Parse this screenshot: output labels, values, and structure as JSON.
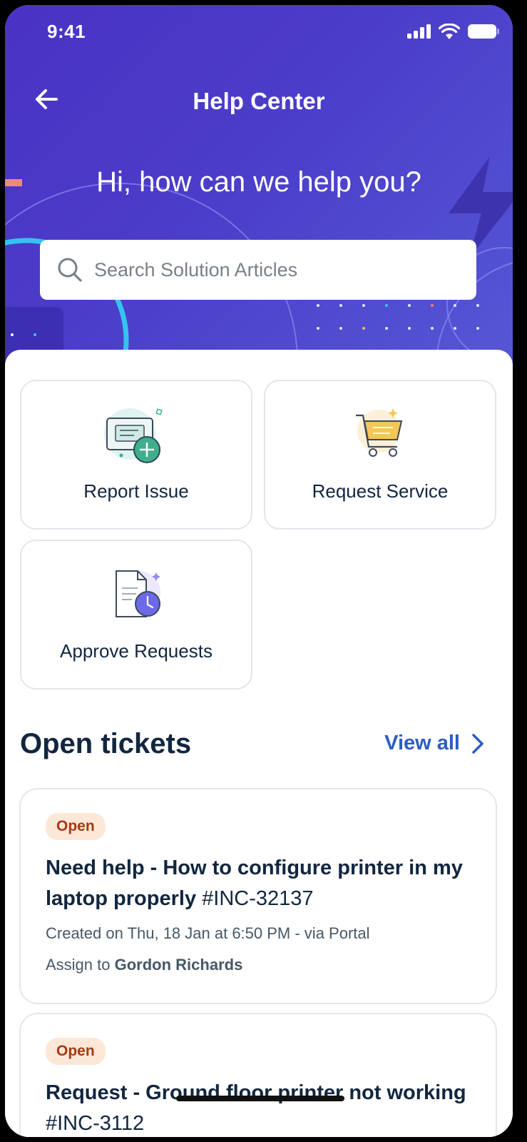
{
  "status_bar": {
    "time": "9:41"
  },
  "header": {
    "title": "Help Center",
    "greeting": "Hi, how can we help you?"
  },
  "search": {
    "placeholder": "Search Solution Articles"
  },
  "actions": [
    {
      "label": "Report Issue",
      "icon": "report-issue-icon"
    },
    {
      "label": "Request Service",
      "icon": "shopping-cart-icon"
    },
    {
      "label": "Approve Requests",
      "icon": "document-clock-icon"
    }
  ],
  "open_tickets": {
    "title": "Open tickets",
    "view_all": "View all",
    "tickets": [
      {
        "status": "Open",
        "title": "Need help - How to configure printer in my laptop properly",
        "id": "#INC-32137",
        "meta": "Created on Thu, 18 Jan at 6:50 PM - via Portal",
        "assign_prefix": "Assign to",
        "assignee": "Gordon Richards"
      },
      {
        "status": "Open",
        "title": "Request - Ground floor printer not working",
        "id": "#INC-3112"
      }
    ]
  },
  "colors": {
    "hero_gradient_start": "#4a32c4",
    "hero_gradient_end": "#5557d6",
    "accent_link": "#2c5cc5",
    "text_dark": "#12263f",
    "badge_bg": "#fde8d8",
    "badge_text": "#a63a12"
  }
}
